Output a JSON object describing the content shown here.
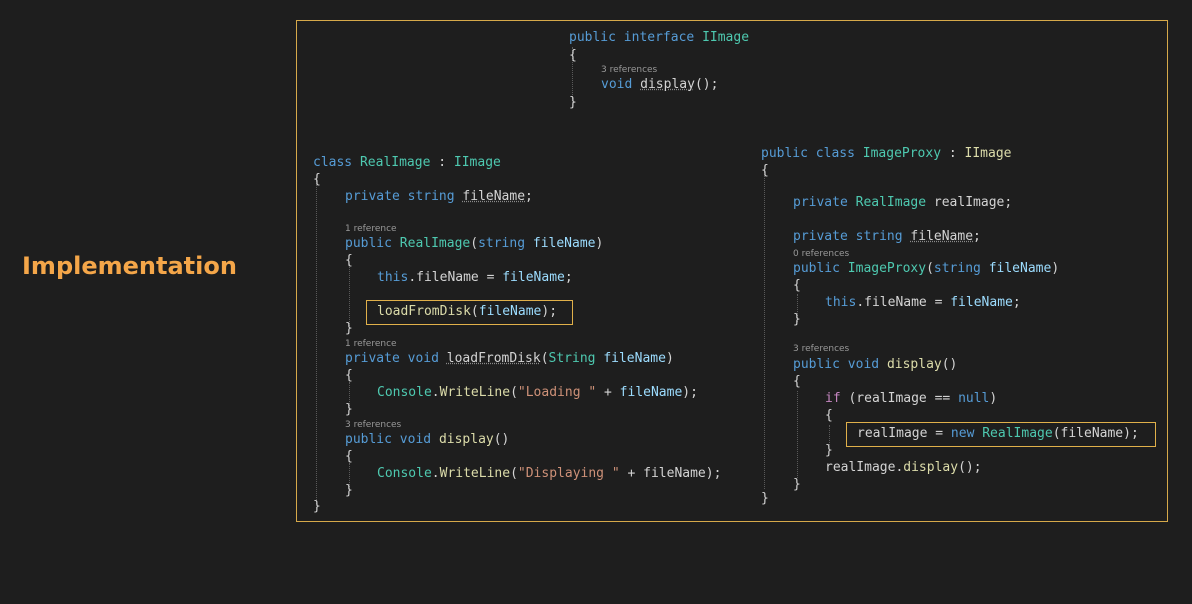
{
  "slide": {
    "title": "Implementation"
  },
  "iimage": {
    "line1": {
      "a": "public",
      "b": " ",
      "c": "interface",
      "d": " ",
      "e": "IImage"
    },
    "open": "{",
    "display_refs": "3 references",
    "display": {
      "a": "void",
      "b": " ",
      "c": "display",
      "d": "();"
    },
    "close": "}"
  },
  "real_image": {
    "line1": {
      "a": "class",
      "b": " ",
      "c": "RealImage",
      "d": " : ",
      "e": "IImage"
    },
    "open": "{",
    "field": {
      "a": "private",
      "b": " ",
      "c": "string",
      "d": " ",
      "e": "fileName",
      "f": ";"
    },
    "ctor_refs": "1 reference",
    "ctor": {
      "a": "public",
      "b": " ",
      "c": "RealImage",
      "d": "(",
      "e": "string",
      "f": " ",
      "g": "fileName",
      "h": ")"
    },
    "ctor_open": "{",
    "assign": {
      "a": "this",
      "b": ".fileName = ",
      "c": "fileName",
      "d": ";"
    },
    "load_call": {
      "a": "loadFromDisk",
      "b": "(",
      "c": "fileName",
      "d": ");"
    },
    "ctor_close": "}",
    "load_refs": "1 reference",
    "load": {
      "a": "private",
      "b": " ",
      "c": "void",
      "d": " ",
      "e": "loadFromDisk",
      "f": "(",
      "g": "String",
      "h": " ",
      "i": "fileName",
      "j": ")"
    },
    "load_open": "{",
    "load_body": {
      "a": "Console",
      "b": ".",
      "c": "WriteLine",
      "d": "(",
      "e": "\"Loading \"",
      "f": " + ",
      "g": "fileName",
      "h": ");"
    },
    "load_close": "}",
    "display_refs": "3 references",
    "display": {
      "a": "public",
      "b": " ",
      "c": "void",
      "d": " ",
      "e": "display",
      "f": "()"
    },
    "display_open": "{",
    "display_body": {
      "a": "Console",
      "b": ".",
      "c": "WriteLine",
      "d": "(",
      "e": "\"Displaying \"",
      "f": " + ",
      "g": "fileName",
      "h": ");"
    },
    "display_close": "}",
    "close": "}"
  },
  "image_proxy": {
    "line1": {
      "a": "public",
      "b": " ",
      "c": "class",
      "d": " ",
      "e": "ImageProxy",
      "f": " : ",
      "g": "IImage"
    },
    "open": "{",
    "field1": {
      "a": "private",
      "b": " ",
      "c": "RealImage",
      "d": " ",
      "e": "realImage;"
    },
    "field2": {
      "a": "private",
      "b": " ",
      "c": "string",
      "d": " ",
      "e": "fileName",
      "f": ";"
    },
    "ctor_refs": "0 references",
    "ctor": {
      "a": "public",
      "b": " ",
      "c": "ImageProxy",
      "d": "(",
      "e": "string",
      "f": " ",
      "g": "fileName",
      "h": ")"
    },
    "ctor_open": "{",
    "assign": {
      "a": "this",
      "b": ".fileName = ",
      "c": "fileName",
      "d": ";"
    },
    "ctor_close": "}",
    "display_refs": "3 references",
    "display": {
      "a": "public",
      "b": " ",
      "c": "void",
      "d": " ",
      "e": "display",
      "f": "()"
    },
    "display_open": "{",
    "if_line": {
      "a": "if",
      "b": " (realImage == ",
      "c": "null",
      "d": ")"
    },
    "if_open": "{",
    "new_line": {
      "a": "realImage = ",
      "b": "new",
      "c": " ",
      "d": "RealImage",
      "e": "(fileName);"
    },
    "if_close": "}",
    "call_display": {
      "a": "realImage.",
      "b": "display",
      "c": "();"
    },
    "display_close": "}",
    "close": "}"
  }
}
